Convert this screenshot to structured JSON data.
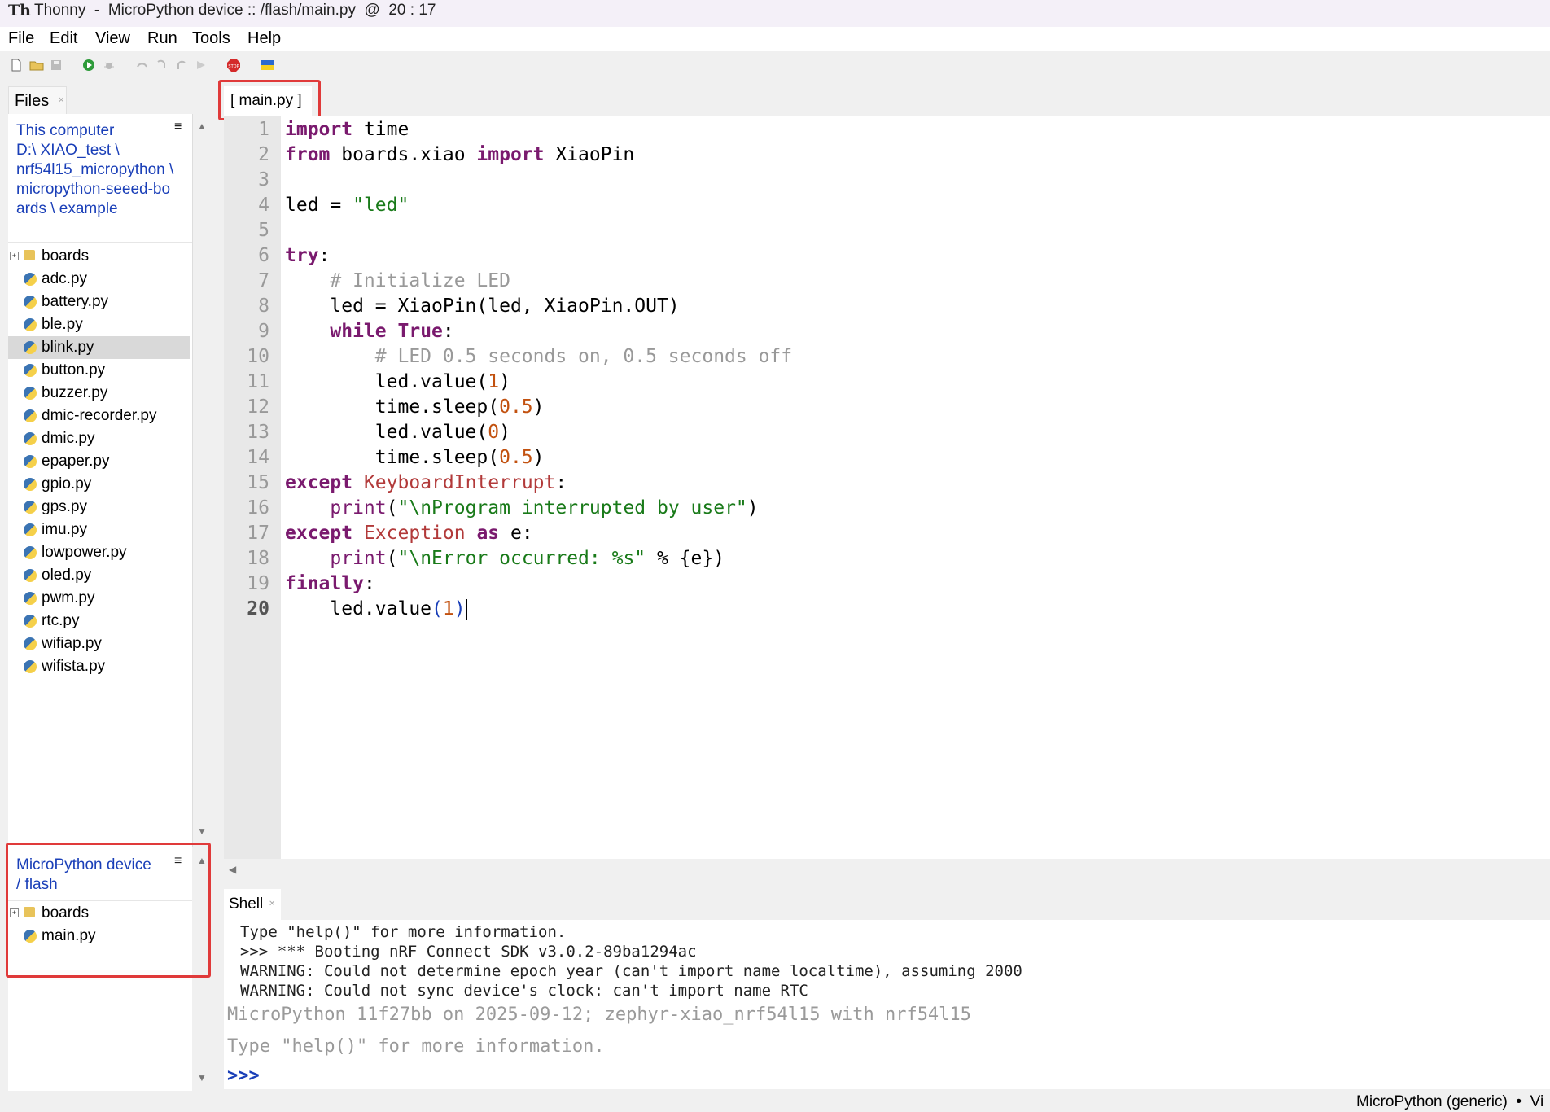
{
  "window": {
    "logo": "Th",
    "title": "Thonny  -  MicroPython device :: /flash/main.py  @  20 : 17"
  },
  "menu": [
    "File",
    "Edit",
    "View",
    "Run",
    "Tools",
    "Help"
  ],
  "files_panel": {
    "tab_label": "Files",
    "local_path_lines": [
      "This computer",
      "D:\\ XIAO_test \\",
      "nrf54l15_micropython \\",
      "micropython-seeed-bo",
      "ards \\ example"
    ],
    "local_items": [
      "boards",
      "adc.py",
      "battery.py",
      "ble.py",
      "blink.py",
      "button.py",
      "buzzer.py",
      "dmic-recorder.py",
      "dmic.py",
      "epaper.py",
      "gpio.py",
      "gps.py",
      "imu.py",
      "lowpower.py",
      "oled.py",
      "pwm.py",
      "rtc.py",
      "wifiap.py",
      "wifista.py"
    ],
    "device_path_lines": [
      "MicroPython device",
      "/ flash"
    ],
    "device_items": [
      "boards",
      "main.py"
    ]
  },
  "editor": {
    "tab_label": "[ main.py ]",
    "line_numbers": [
      "1",
      "2",
      "3",
      "4",
      "5",
      "6",
      "7",
      "8",
      "9",
      "10",
      "11",
      "12",
      "13",
      "14",
      "15",
      "16",
      "17",
      "18",
      "19",
      "20"
    ],
    "current_line": "20"
  },
  "shell": {
    "tab_label": "Shell",
    "lines": [
      "Type \"help()\" for more information.",
      ">>> *** Booting nRF Connect SDK v3.0.2-89ba1294ac",
      "WARNING: Could not determine epoch year (can't import name localtime), assuming 2000",
      "WARNING: Could not sync device's clock: can't import name RTC"
    ],
    "banner": "MicroPython 11f27bb on 2025-09-12; zephyr-xiao_nrf54l15 with nrf54l15",
    "help_hint": "Type \"help()\" for more information.",
    "prompt": ">>>"
  },
  "status": {
    "interpreter": "MicroPython (generic)  •  Vi"
  },
  "colors": {
    "highlight_box": "#e03a3a",
    "keyword": "#7a1a6e",
    "string": "#197a19",
    "number": "#c2510f",
    "comment": "#999999",
    "link": "#1a3fb8"
  }
}
